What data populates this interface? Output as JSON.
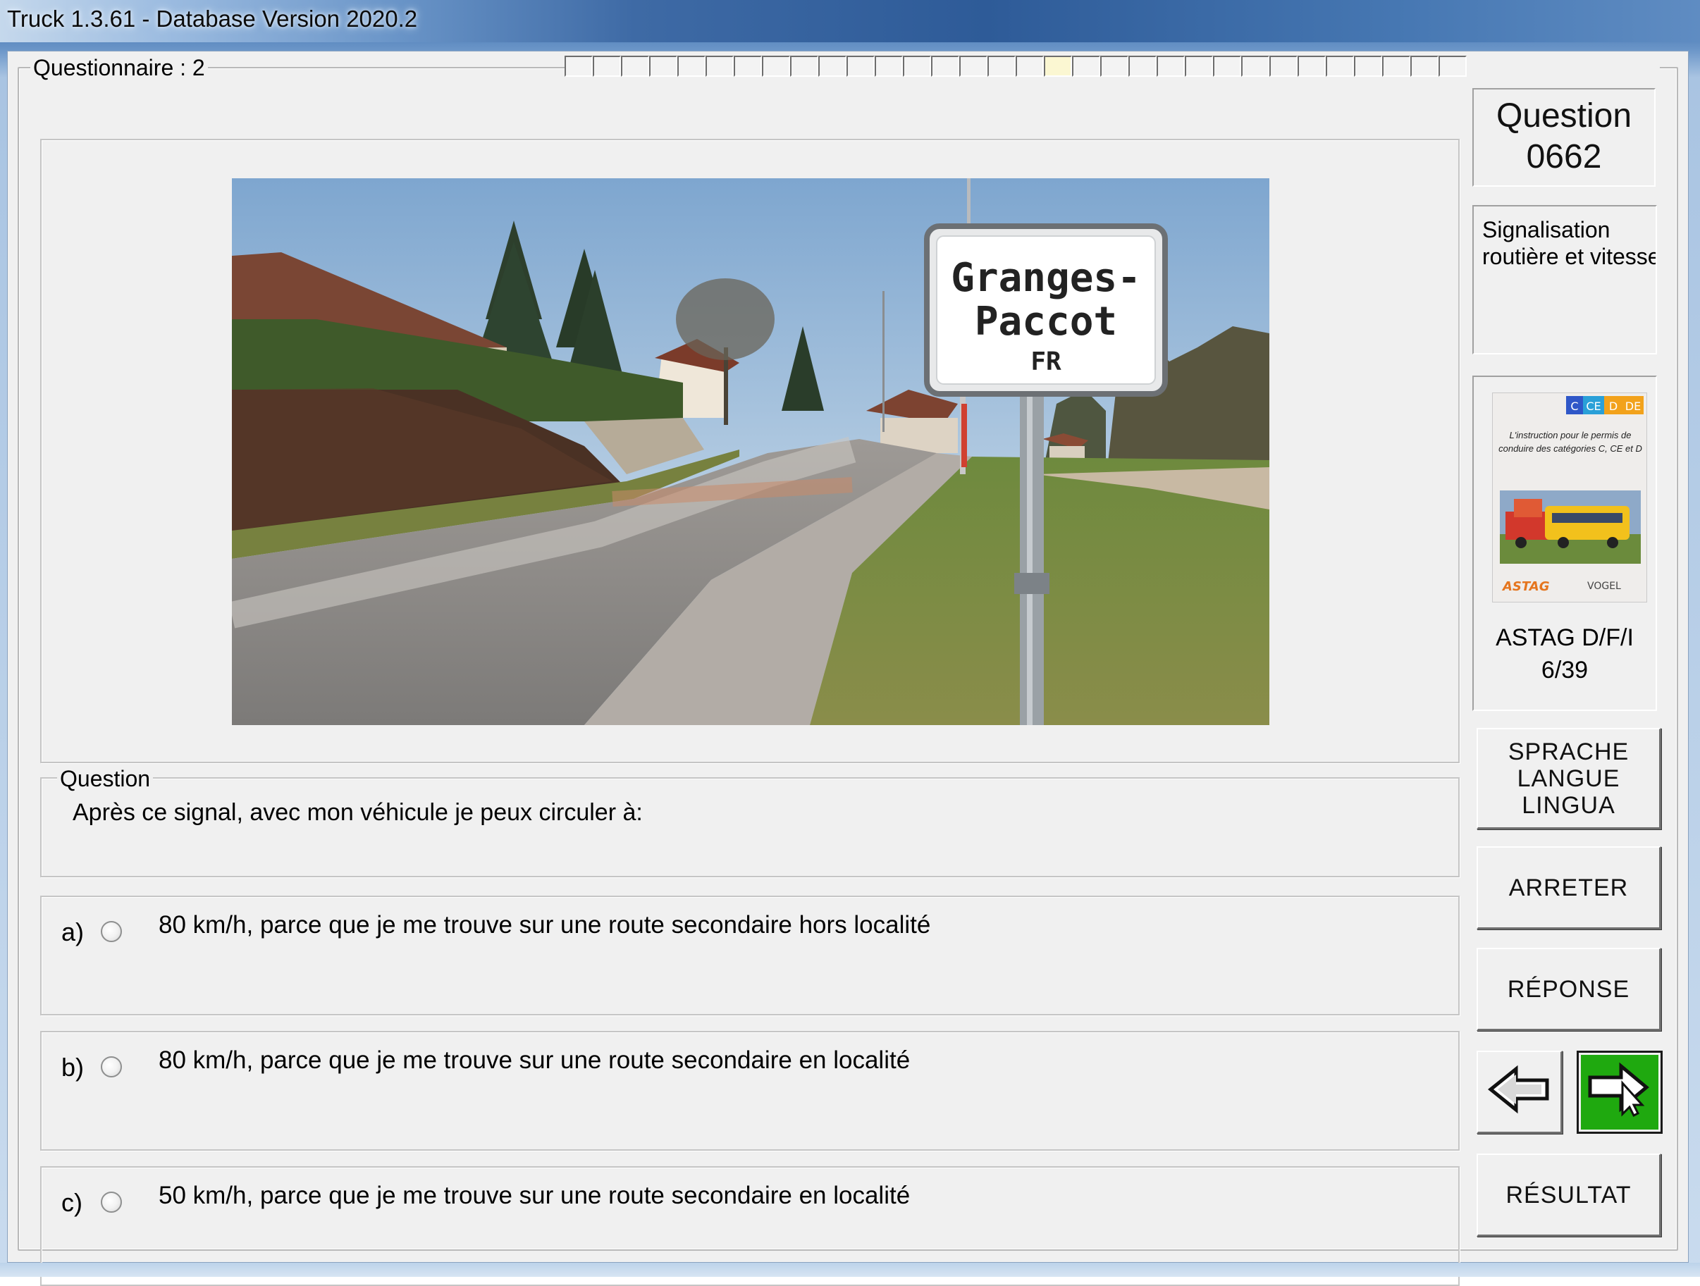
{
  "window": {
    "title": "Truck 1.3.61 - Database Version 2020.2"
  },
  "questionnaire": {
    "label": "Questionnaire : 2",
    "progress_total": 32,
    "progress_current": 17
  },
  "photo": {
    "sign_line1": "Granges-",
    "sign_line2": "Paccot",
    "sign_canton": "FR"
  },
  "question": {
    "legend": "Question",
    "text": "Après ce signal, avec mon véhicule je peux circuler à:"
  },
  "answers": [
    {
      "letter": "a)",
      "text": "80 km/h, parce que je me trouve sur une route secondaire hors localité",
      "selected": false
    },
    {
      "letter": "b)",
      "text": "80 km/h, parce que je me trouve sur une route secondaire en localité",
      "selected": false
    },
    {
      "letter": "c)",
      "text": "50 km/h, parce que je me trouve sur une route secondaire en localité",
      "selected": false
    }
  ],
  "sidebar": {
    "question_label": "Question",
    "question_number": "0662",
    "category": "Signalisation routière et vitesse",
    "book": {
      "badges": [
        "C",
        "CE",
        "D",
        "DE"
      ],
      "badge_colors": [
        "#2f57c8",
        "#2aa0d8",
        "#f2a21b",
        "#f2a21b"
      ],
      "title_text": "L'instruction pour le permis de conduire des catégories C, CE et D",
      "publisher_left": "ASTAG",
      "publisher_right": "VOGEL"
    },
    "source": "ASTAG D/F/I",
    "pages": "6/39",
    "language_button": [
      "SPRACHE",
      "LANGUE",
      "LINGUA"
    ],
    "stop_button": "ARRETER",
    "answer_button": "RÉPONSE",
    "result_button": "RÉSULTAT",
    "prev_icon": "arrow-left-icon",
    "next_icon": "arrow-right-cursor-icon",
    "next_color": "#1fa90f"
  }
}
